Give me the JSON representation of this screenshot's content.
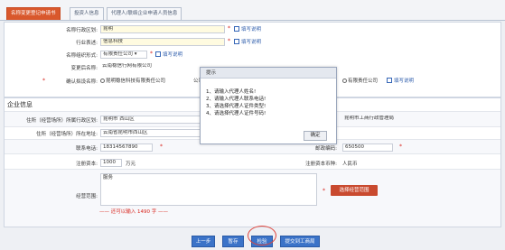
{
  "tabs": [
    {
      "label": "名称变更登记申请书",
      "active": true
    },
    {
      "label": "投资人信息",
      "active": false
    },
    {
      "label": "代理人/联络企业申请人员信息",
      "active": false
    }
  ],
  "form": {
    "name_label": "名称行政区划:",
    "name_value": "昆明",
    "name_help": "填写说明",
    "industry_label": "行业表述:",
    "industry_value": "信息科技",
    "industry_help": "填写说明",
    "org_label": "名称组织形式:",
    "org_value": "有限责任公司",
    "org_help": "填写说明",
    "changed_name_label": "变更后名称:",
    "changed_name_value": "云南稳信行网有限公司",
    "confirm_label": "确认拟设名称:",
    "confirm_option1": "昆明稳信科技有限责任公司",
    "confirm_option1_tail": "公司",
    "confirm_option2": "有限责任公司",
    "confirm_help": "填写说明"
  },
  "section": {
    "title": "企业信息",
    "region_label": "住所（经营场所）所属行政区划:",
    "region_value": "昆明市 西山区",
    "authority_value": "昆明市工商行政管理局",
    "address_label": "住所（经营场所）所在地址:",
    "address_value": "云南省昆明市西山区",
    "phone_label": "联系电话:",
    "phone_value": "18314567890",
    "postcode_label": "邮政编码:",
    "postcode_value": "650500",
    "capital_label": "注册资本:",
    "capital_value": "1000",
    "capital_unit": "万元",
    "currency_label": "注册资本币种:",
    "currency_value": "人民币",
    "scope_label": "经营范围:",
    "scope_value": "服务",
    "scope_button": "选择经营范围",
    "warning": "—— 还可以输入  1490  字  ——"
  },
  "modal": {
    "title": "提示",
    "lines": [
      "1、请输入代理人姓名!",
      "2、请输入代理人联系电话!",
      "3、请选择代理人证件类型!",
      "4、请选择代理人证件号码!"
    ],
    "ok": "确定"
  },
  "buttons": {
    "prev": "上一步",
    "save": "暂存",
    "check": "检验",
    "submit": "提交到工商局"
  }
}
